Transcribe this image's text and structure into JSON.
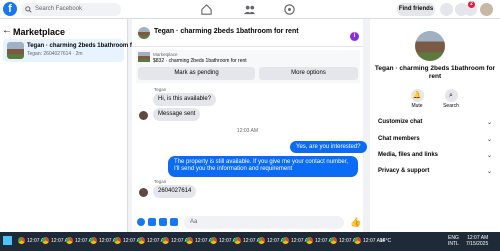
{
  "topbar": {
    "search_placeholder": "Search Facebook",
    "find_friends": "Find friends",
    "notif_count": "2"
  },
  "left": {
    "title": "Marketplace",
    "item": {
      "name": "Tegan · charming 2beds 1bathroom fo",
      "sub": "Tegan: 2604027614 · 2m"
    }
  },
  "chat": {
    "title": "Tegan · charming 2beds 1bathroom for rent",
    "listing_label": "Marketplace",
    "listing_price": "$832 · charming 2beds 1bathroom for rent",
    "mark_pending": "Mark as pending",
    "more_options": "More options",
    "messages": [
      {
        "sender": "Tegan",
        "text": "Hi, is this available?"
      },
      {
        "text": "Message sent"
      }
    ],
    "timestamp": "12:03 AM",
    "out1": "Yes, are you interested?",
    "out2": "The property is still available. If you give me your contact number, I'll send you the information and requirement",
    "reply_sender": "Tegan",
    "reply_text": "2604027614",
    "composer_placeholder": "Aa"
  },
  "right": {
    "title": "Tegan · charming 2beds 1bathroom for rent",
    "mute": "Mute",
    "search": "Search",
    "sections": [
      "Customize chat",
      "Chat members",
      "Media, files and links",
      "Privacy & support"
    ]
  },
  "taskbar": {
    "items": [
      "12:07 AM",
      "12:07 AM",
      "12:07 AM",
      "12:07 AM",
      "12:07 AM",
      "12:07 AM",
      "12:07 AM",
      "12:07 AM",
      "12:07 AM",
      "12:07 AM",
      "12:07 AM",
      "12:07 AM",
      "12:07 AM",
      "12:07 AM",
      "12:07 AM"
    ],
    "weather": "14°C",
    "lang": "ENG",
    "lang2": "INTL",
    "time": "12:07 AM",
    "date": "7/15/2025"
  }
}
